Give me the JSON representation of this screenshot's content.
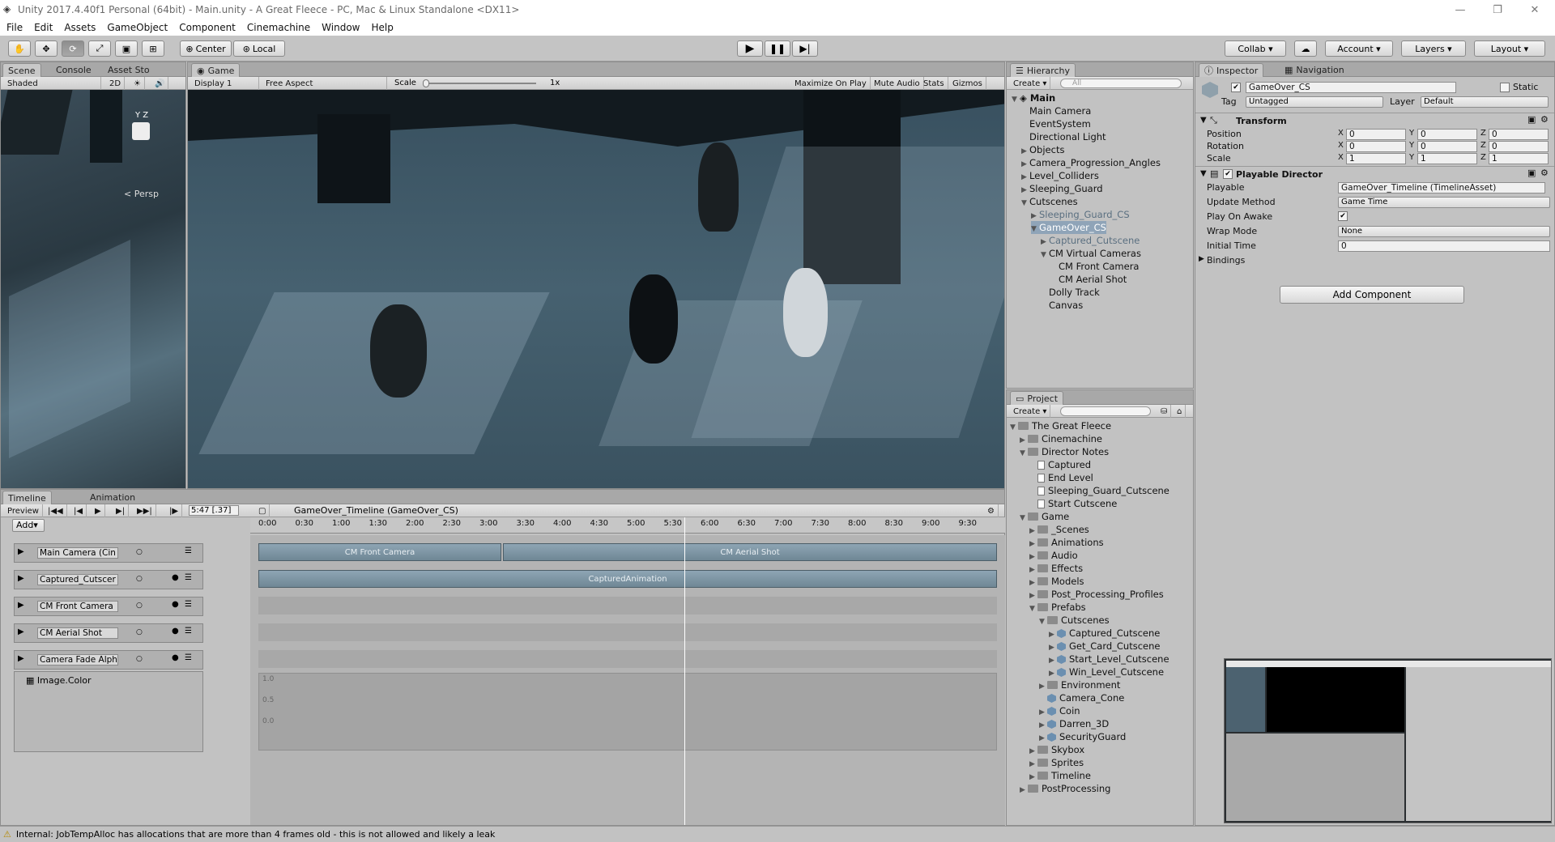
{
  "window": {
    "title": "Unity 2017.4.40f1 Personal (64bit) - Main.unity - A Great Fleece - PC, Mac & Linux Standalone <DX11>",
    "minimize": "—",
    "maximize": "❐",
    "close": "✕"
  },
  "menu": [
    "File",
    "Edit",
    "Assets",
    "GameObject",
    "Component",
    "Cinemachine",
    "Window",
    "Help"
  ],
  "toolbar": {
    "center": "Center",
    "local": "Local",
    "collab": "Collab",
    "account": "Account",
    "layers": "Layers",
    "layout": "Layout"
  },
  "scene_panel": {
    "tabs": [
      "Scene",
      "Console",
      "Asset Sto"
    ],
    "shaded": "Shaded",
    "mode_2d": "2D",
    "persp": "< Persp"
  },
  "game_panel": {
    "tab": "Game",
    "display": "Display 1",
    "aspect": "Free Aspect",
    "scale_label": "Scale",
    "scale_value": "1x",
    "buttons": [
      "Maximize On Play",
      "Mute Audio",
      "Stats",
      "Gizmos"
    ]
  },
  "hierarchy": {
    "tab": "Hierarchy",
    "create": "Create",
    "search_placeholder": "All",
    "scene": "Main",
    "items": [
      "Main Camera",
      "EventSystem",
      "Directional Light",
      "Objects",
      "Camera_Progression_Angles",
      "Level_Colliders",
      "Sleeping_Guard",
      "Cutscenes",
      "Sleeping_Guard_CS",
      "GameOver_CS",
      "Captured_Cutscene",
      "CM Virtual Cameras",
      "CM Front Camera",
      "CM Aerial Shot",
      "Dolly Track",
      "Canvas"
    ]
  },
  "project": {
    "tab": "Project",
    "create": "Create",
    "items": [
      "The Great Fleece",
      "Cinemachine",
      "Director Notes",
      "Captured",
      "End Level",
      "Sleeping_Guard_Cutscene",
      "Start Cutscene",
      "Game",
      "_Scenes",
      "Animations",
      "Audio",
      "Effects",
      "Models",
      "Post_Processing_Profiles",
      "Prefabs",
      "Cutscenes",
      "Captured_Cutscene",
      "Get_Card_Cutscene",
      "Start_Level_Cutscene",
      "Win_Level_Cutscene",
      "Environment",
      "Camera_Cone",
      "Coin",
      "Darren_3D",
      "SecurityGuard",
      "Skybox",
      "Sprites",
      "Timeline",
      "PostProcessing"
    ]
  },
  "inspector": {
    "tabs": [
      "Inspector",
      "Navigation"
    ],
    "object_name": "GameOver_CS",
    "static": "Static",
    "tag_label": "Tag",
    "tag": "Untagged",
    "layer_label": "Layer",
    "layer": "Default",
    "transform": {
      "title": "Transform",
      "rows": [
        {
          "label": "Position",
          "x": "0",
          "y": "0",
          "z": "0"
        },
        {
          "label": "Rotation",
          "x": "0",
          "y": "0",
          "z": "0"
        },
        {
          "label": "Scale",
          "x": "1",
          "y": "1",
          "z": "1"
        }
      ]
    },
    "director": {
      "title": "Playable Director",
      "playable_label": "Playable",
      "playable": "GameOver_Timeline (TimelineAsset)",
      "update_label": "Update Method",
      "update": "Game Time",
      "awake_label": "Play On Awake",
      "wrap_label": "Wrap Mode",
      "wrap": "None",
      "initial_label": "Initial Time",
      "initial": "0",
      "bindings": "Bindings"
    },
    "add_component": "Add Component"
  },
  "timeline": {
    "tabs": [
      "Timeline",
      "Animation"
    ],
    "preview": "Preview",
    "time": "5:47 [.37]",
    "asset": "GameOver_Timeline (GameOver_CS)",
    "add": "Add",
    "ruler": [
      "0:00",
      "0:30",
      "1:00",
      "1:30",
      "2:00",
      "2:30",
      "3:00",
      "3:30",
      "4:00",
      "4:30",
      "5:00",
      "5:30",
      "6:00",
      "6:30",
      "7:00",
      "7:30",
      "8:00",
      "8:30",
      "9:00",
      "9:30"
    ],
    "tracks": [
      "Main Camera (Cin",
      "Captured_Cutscer",
      "CM Front Camera",
      "CM Aerial Shot",
      "Camera Fade Alph"
    ],
    "property": "Image.Color",
    "clips": [
      "CM Front Camera",
      "CM Aerial Shot",
      "CapturedAnimation"
    ],
    "curve_labels": [
      "1.0",
      "0.5",
      "0.0"
    ]
  },
  "status": "Internal: JobTempAlloc has allocations that are more than 4 frames old - this is not allowed and likely a leak"
}
